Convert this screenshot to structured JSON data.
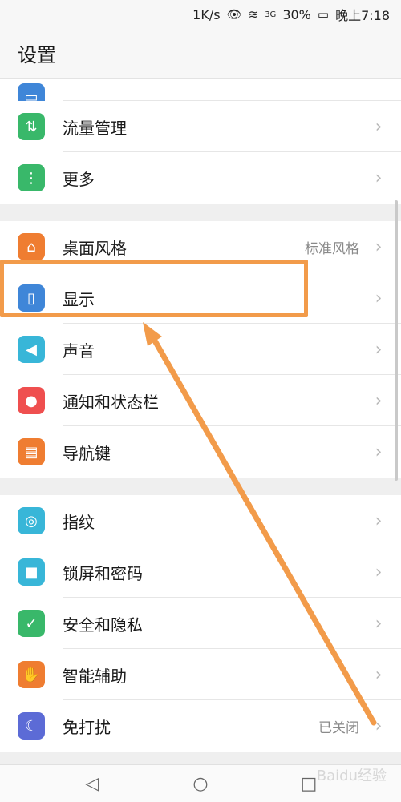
{
  "statusbar": {
    "speed": "1K/s",
    "eye": "👁",
    "wifi": "≋",
    "network": "3G",
    "battery_pct": "30%",
    "time": "晚上7:18"
  },
  "header": {
    "title": "设置"
  },
  "groups": [
    {
      "partial_item": {
        "label": "",
        "icon": "blue-top-icon",
        "color": "#3f86d8",
        "value": ""
      },
      "items": [
        {
          "label": "流量管理",
          "icon": "data-usage-icon",
          "color": "#39b86a",
          "value": ""
        },
        {
          "label": "更多",
          "icon": "more-dots-icon",
          "color": "#39b86a",
          "value": ""
        }
      ]
    },
    {
      "items": [
        {
          "label": "桌面风格",
          "icon": "home-style-icon",
          "color": "#ef7d31",
          "value": "标准风格"
        },
        {
          "label": "显示",
          "icon": "display-icon",
          "color": "#3f86d8",
          "value": ""
        },
        {
          "label": "声音",
          "icon": "sound-icon",
          "color": "#38b6d8",
          "value": ""
        },
        {
          "label": "通知和状态栏",
          "icon": "bell-icon",
          "color": "#ef4f4f",
          "value": ""
        },
        {
          "label": "导航键",
          "icon": "nav-key-icon",
          "color": "#ef7d31",
          "value": ""
        }
      ]
    },
    {
      "items": [
        {
          "label": "指纹",
          "icon": "fingerprint-icon",
          "color": "#38b6d8",
          "value": ""
        },
        {
          "label": "锁屏和密码",
          "icon": "lock-icon",
          "color": "#38b6d8",
          "value": ""
        },
        {
          "label": "安全和隐私",
          "icon": "shield-icon",
          "color": "#39b86a",
          "value": ""
        },
        {
          "label": "智能辅助",
          "icon": "hand-icon",
          "color": "#ef7d31",
          "value": ""
        },
        {
          "label": "免打扰",
          "icon": "moon-icon",
          "color": "#5c6bd6",
          "value": "已关闭"
        }
      ]
    }
  ],
  "navbar": {
    "back": "◁",
    "home": "○",
    "recents": "□"
  },
  "watermark": "Baidu经验",
  "annotation": {
    "highlight_color": "#f29b4a"
  }
}
